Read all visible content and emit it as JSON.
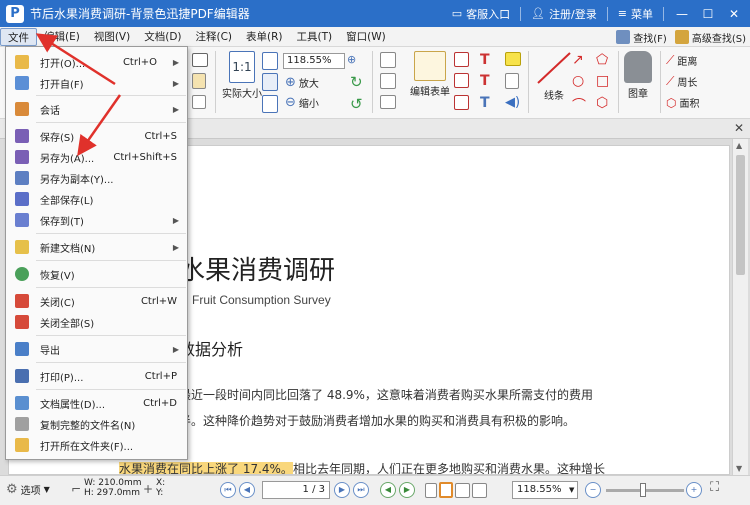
{
  "titlebar": {
    "logo": "P",
    "title": "节后水果消费调研-背景色迅捷PDF编辑器",
    "support": "客服入口",
    "login": "注册/登录",
    "menu": "菜单"
  },
  "menubar": {
    "items": [
      "文件",
      "编辑(E)",
      "视图(V)",
      "文档(D)",
      "注释(C)",
      "表单(R)",
      "工具(T)",
      "窗口(W)"
    ],
    "find": "查找(F)",
    "advanced_find": "高级查找(S)"
  },
  "ribbon": {
    "zoom": "118.55%",
    "actual_size": "实际大小",
    "zoom_in": "放大",
    "zoom_out": "缩小",
    "edit_form": "编辑表单",
    "line": "线条",
    "stamp": "图章",
    "distance": "距离",
    "perimeter": "周长",
    "area": "面积"
  },
  "file_menu": [
    {
      "label": "打开(O)...",
      "shortcut": "Ctrl+O",
      "submenu": true,
      "color": "#e9b949"
    },
    {
      "label": "打开自(F)",
      "shortcut": "",
      "submenu": true,
      "color": "#5b8fd6"
    },
    {
      "label": "会话",
      "shortcut": "",
      "submenu": true,
      "color": "#d98a3a"
    },
    {
      "label": "保存(S)",
      "shortcut": "Ctrl+S",
      "submenu": false,
      "color": "#7a5fb5"
    },
    {
      "label": "另存为(A)...",
      "shortcut": "Ctrl+Shift+S",
      "submenu": false,
      "color": "#7a5fb5"
    },
    {
      "label": "另存为副本(Y)...",
      "shortcut": "",
      "submenu": false,
      "color": "#5d7fc2"
    },
    {
      "label": "全部保存(L)",
      "shortcut": "",
      "submenu": false,
      "color": "#5b6fc8"
    },
    {
      "label": "保存到(T)",
      "shortcut": "",
      "submenu": true,
      "color": "#6a7fd0"
    },
    {
      "label": "新建文档(N)",
      "shortcut": "",
      "submenu": true,
      "color": "#e6c04a"
    },
    {
      "label": "恢复(V)",
      "shortcut": "",
      "submenu": false,
      "color": "#4aa05a"
    },
    {
      "label": "关闭(C)",
      "shortcut": "Ctrl+W",
      "submenu": false,
      "color": "#d64a3a"
    },
    {
      "label": "关闭全部(S)",
      "shortcut": "",
      "submenu": false,
      "color": "#d64a3a"
    },
    {
      "label": "导出",
      "shortcut": "",
      "submenu": true,
      "color": "#4a7fc8"
    },
    {
      "label": "打印(P)...",
      "shortcut": "Ctrl+P",
      "submenu": false,
      "color": "#4a6fb0"
    },
    {
      "label": "文档属性(D)...",
      "shortcut": "Ctrl+D",
      "submenu": false,
      "color": "#5a8fd0"
    },
    {
      "label": "复制完整的文件名(N)",
      "shortcut": "",
      "submenu": false,
      "color": "#a0a0a0"
    },
    {
      "label": "打开所在文件夹(F)...",
      "shortcut": "",
      "submenu": false,
      "color": "#e9b949"
    }
  ],
  "document": {
    "title": "水果消费调研",
    "subtitle": "Fruit Consumption Survey",
    "heading": "数据分析",
    "p1": "最近一段时间内同比回落了  48.9%，这意味着消费者购买水果所需支付的费用",
    "p2": "半。这种降价趋势对于鼓励消费者增加水果的购买和消费具有积极的影响。",
    "p3_highlight": "水果消费在同比上涨了 17.4%。",
    "p3_rest": "相比去年同期，人们正在更多地购买和消费水果。这种增长"
  },
  "statusbar": {
    "options": "选项",
    "width": "W: 210.0mm",
    "height": "H: 297.0mm",
    "x": "X:",
    "y": "Y:",
    "page": "1 / 3",
    "zoom": "118.55%"
  }
}
